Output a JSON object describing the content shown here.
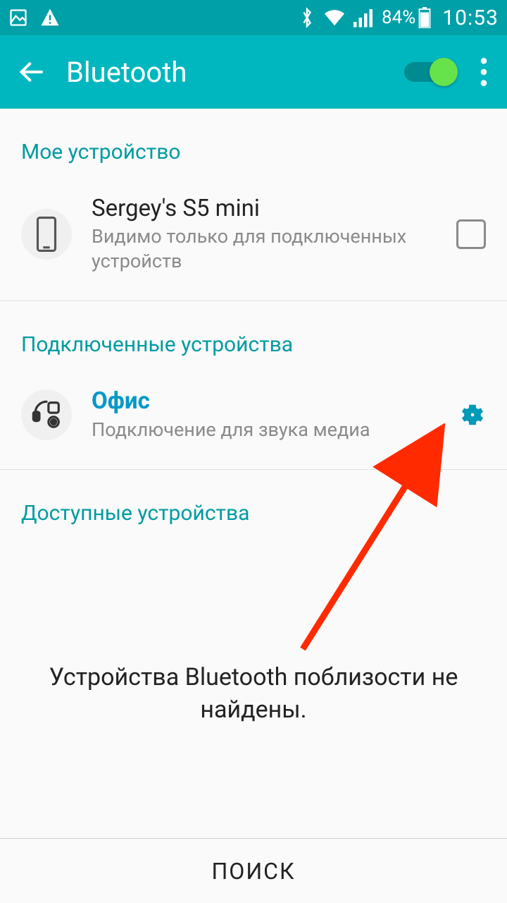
{
  "statusbar": {
    "battery_pct": "84%",
    "time": "10:53"
  },
  "appbar": {
    "title": "Bluetooth"
  },
  "sections": {
    "my_device": {
      "header": "Мое устройство",
      "name": "Sergey's S5 mini",
      "sub": "Видимо только для подключенных устройств"
    },
    "paired": {
      "header": "Подключенные устройства",
      "items": [
        {
          "name": "Офис",
          "sub": "Подключение для звука медиа"
        }
      ]
    },
    "available": {
      "header": "Доступные устройства"
    }
  },
  "empty": "Устройства Bluetooth поблизости не найдены.",
  "footer": {
    "search": "ПОИСК"
  }
}
